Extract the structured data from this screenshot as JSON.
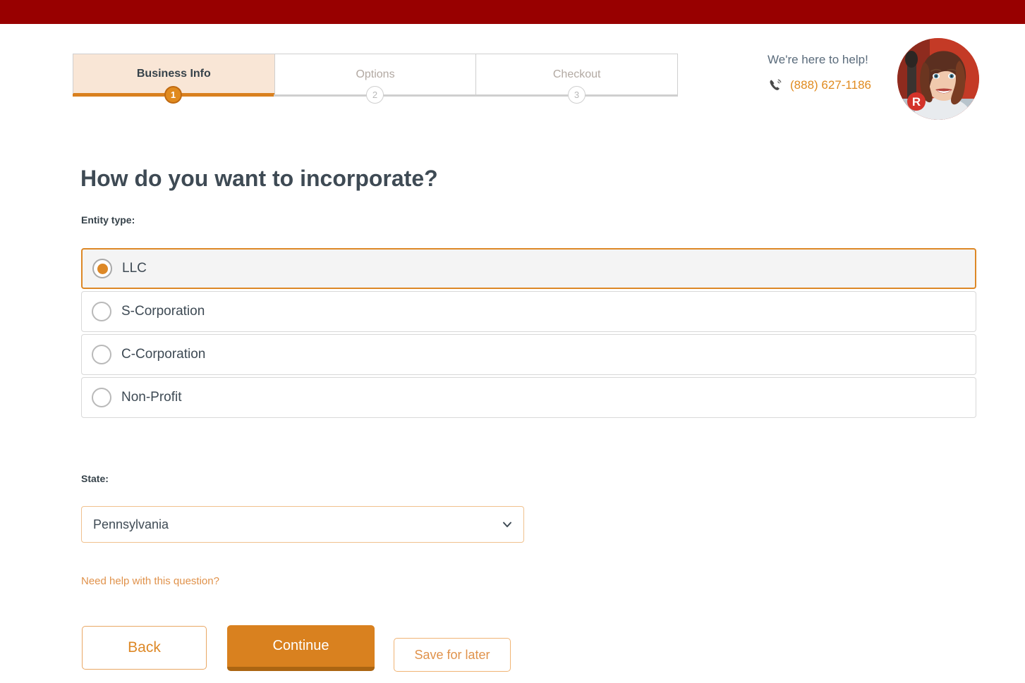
{
  "theme": {
    "topbar_color": "#980000",
    "accent_orange": "#d9811f",
    "accent_orange_light": "#e0924b",
    "text_dark": "#3e4a54",
    "muted": "#b2a9a2"
  },
  "progress": {
    "steps": [
      {
        "label": "Business Info",
        "number": "1",
        "active": true
      },
      {
        "label": "Options",
        "number": "2",
        "active": false
      },
      {
        "label": "Checkout",
        "number": "3",
        "active": false
      }
    ]
  },
  "help": {
    "title": "We're here to help!",
    "phone": "(888) 627-1186",
    "phone_icon": "phone-ringing-icon",
    "avatar_badge": "R"
  },
  "main": {
    "heading": "How do you want to incorporate?",
    "entity_label": "Entity type:",
    "entity_options": [
      {
        "label": "LLC",
        "selected": true
      },
      {
        "label": "S-Corporation",
        "selected": false
      },
      {
        "label": "C-Corporation",
        "selected": false
      },
      {
        "label": "Non-Profit",
        "selected": false
      }
    ],
    "state_label": "State:",
    "state_value": "Pennsylvania",
    "state_caret_icon": "chevron-down-icon",
    "help_link": "Need help with this question?"
  },
  "actions": {
    "back": "Back",
    "continue": "Continue",
    "save": "Save for later"
  }
}
